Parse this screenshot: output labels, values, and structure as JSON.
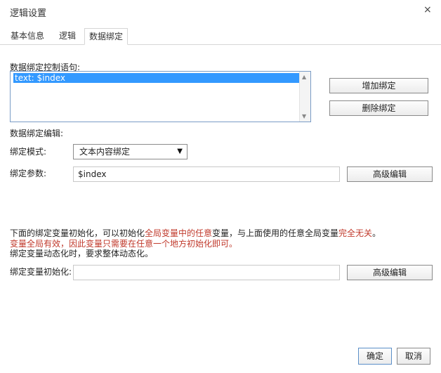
{
  "dialog": {
    "title": "逻辑设置",
    "close_glyph": "×"
  },
  "tabs": [
    {
      "label": "基本信息",
      "active": false
    },
    {
      "label": "逻辑",
      "active": false
    },
    {
      "label": "数据绑定",
      "active": true
    }
  ],
  "binding": {
    "statement_label": "数据绑定控制语句:",
    "list_items": [
      "text: $index"
    ],
    "selected_index": 0,
    "add_button": "增加绑定",
    "delete_button": "删除绑定",
    "editor_label": "数据绑定编辑:",
    "mode_label": "绑定模式:",
    "mode_value": "文本内容绑定",
    "param_label": "绑定参数:",
    "param_value": "$index",
    "advanced_button": "高级编辑"
  },
  "notes": {
    "line1_a": "下面的绑定变量初始化，可以初始化",
    "line1_b": "全局变量中的任意",
    "line1_c": "变量，与上面使用的任意全局变量",
    "line1_d": "完全无关",
    "line1_e": "。",
    "line2": "变量全局有效，因此变量只需要在任意一个地方初始化即可。",
    "line3": "绑定变量动态化时，要求整体动态化。"
  },
  "init": {
    "label": "绑定变量初始化:",
    "value": "",
    "advanced_button": "高级编辑"
  },
  "footer": {
    "ok_button": "确定",
    "cancel_button": "取消"
  },
  "colors": {
    "highlight_red": "#c0392b",
    "selection_blue": "#3399ff"
  }
}
